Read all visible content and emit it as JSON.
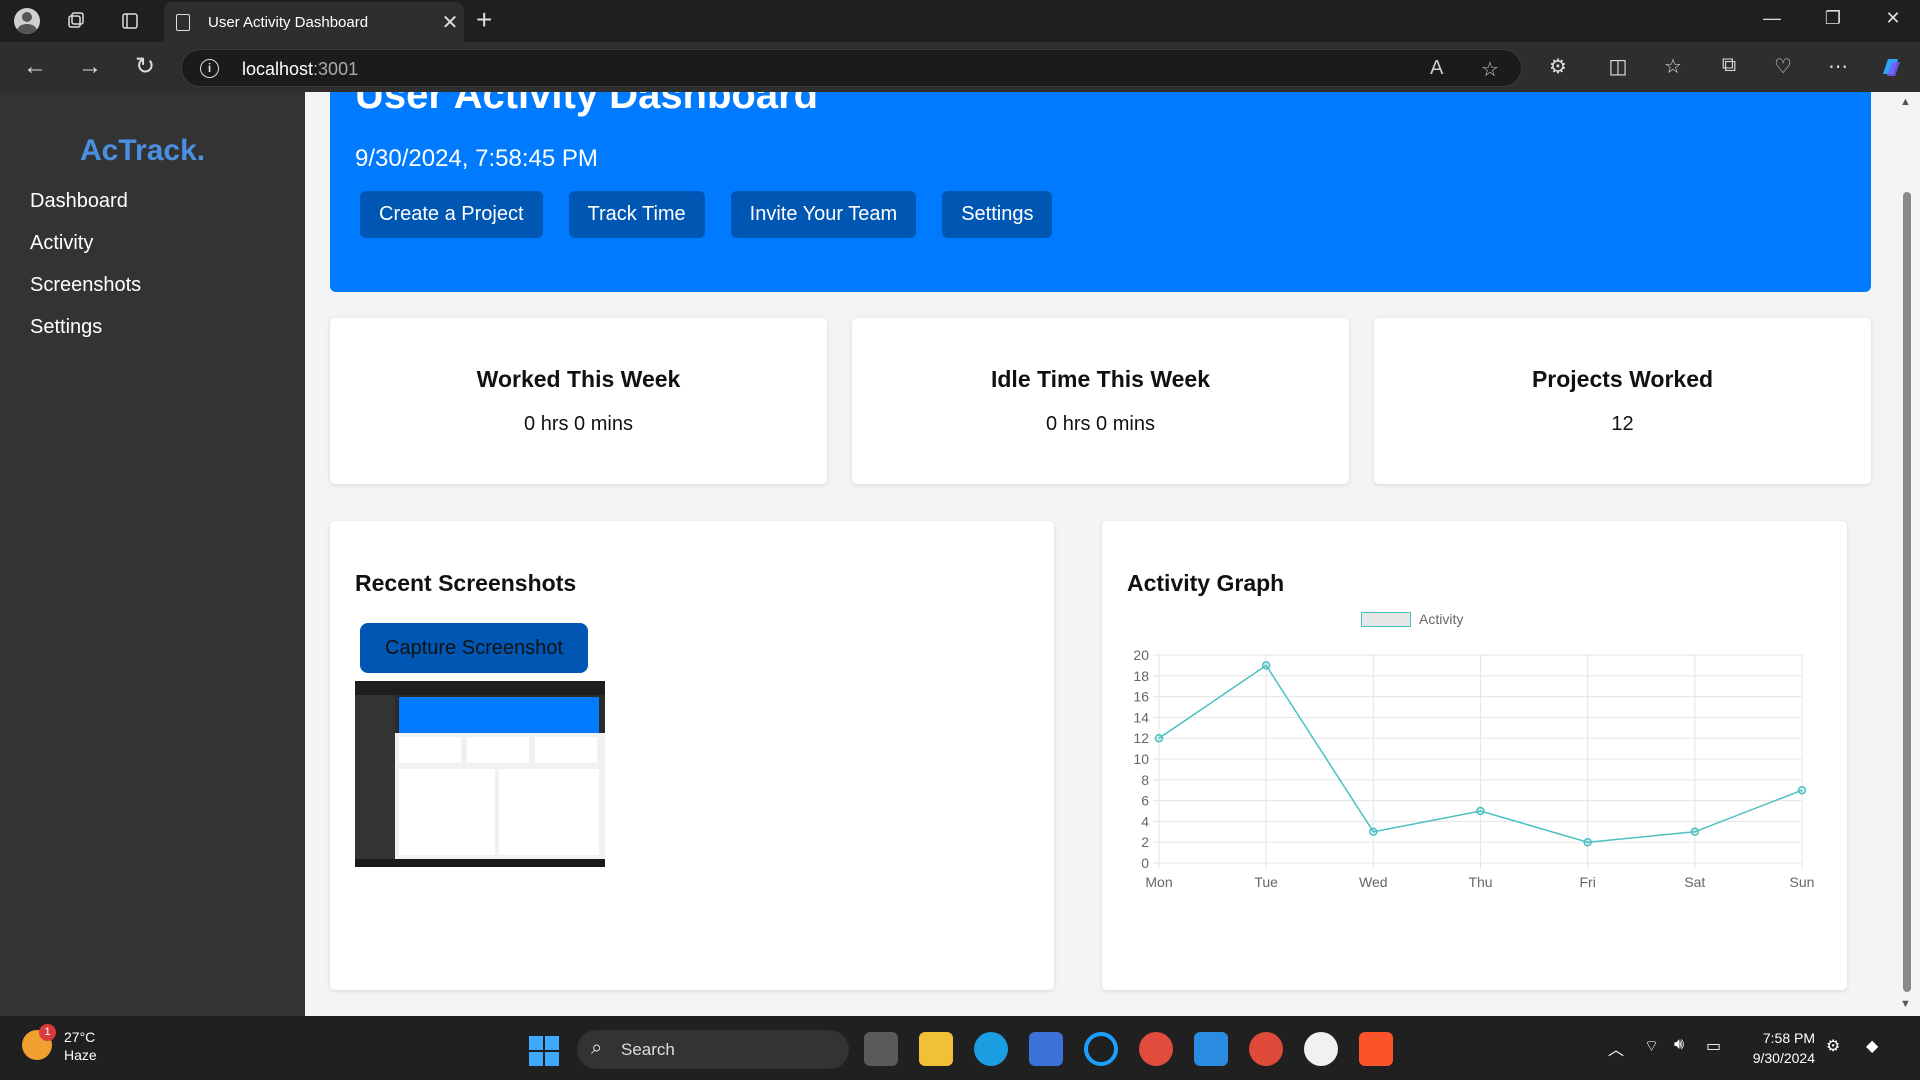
{
  "browser": {
    "tab_title": "User Activity Dashboard",
    "url_host": "localhost",
    "url_port": ":3001"
  },
  "sidebar": {
    "logo": "AcTrack.",
    "items": [
      {
        "label": "Dashboard"
      },
      {
        "label": "Activity"
      },
      {
        "label": "Screenshots"
      },
      {
        "label": "Settings"
      }
    ]
  },
  "header": {
    "title": "User Activity Dashboard",
    "timestamp": "9/30/2024, 7:58:45 PM",
    "buttons": [
      {
        "label": "Create a Project"
      },
      {
        "label": "Track Time"
      },
      {
        "label": "Invite Your Team"
      },
      {
        "label": "Settings"
      }
    ]
  },
  "stats": [
    {
      "title": "Worked This Week",
      "value": "0 hrs 0 mins"
    },
    {
      "title": "Idle Time This Week",
      "value": "0 hrs 0 mins"
    },
    {
      "title": "Projects Worked",
      "value": "12"
    }
  ],
  "screenshots": {
    "title": "Recent Screenshots",
    "capture_label": "Capture Screenshot"
  },
  "graph": {
    "title": "Activity Graph"
  },
  "chart_data": {
    "type": "line",
    "categories": [
      "Mon",
      "Tue",
      "Wed",
      "Thu",
      "Fri",
      "Sat",
      "Sun"
    ],
    "series": [
      {
        "name": "Activity",
        "values": [
          12,
          19,
          3,
          5,
          2,
          3,
          7
        ],
        "color": "#4bc0c0"
      }
    ],
    "yticks": [
      "0",
      "2",
      "4",
      "6",
      "8",
      "10",
      "12",
      "14",
      "16",
      "18",
      "20"
    ],
    "ylim": [
      0,
      20
    ],
    "grid": true,
    "legend": "top"
  },
  "taskbar": {
    "temperature": "27°C",
    "condition": "Haze",
    "notification_count": "1",
    "search_label": "Search",
    "time": "7:58 PM",
    "date": "9/30/2024"
  },
  "colors": {
    "accent": "#007bff",
    "button": "#0056b3",
    "logo": "#4a90e2",
    "sidebar": "#333333"
  }
}
